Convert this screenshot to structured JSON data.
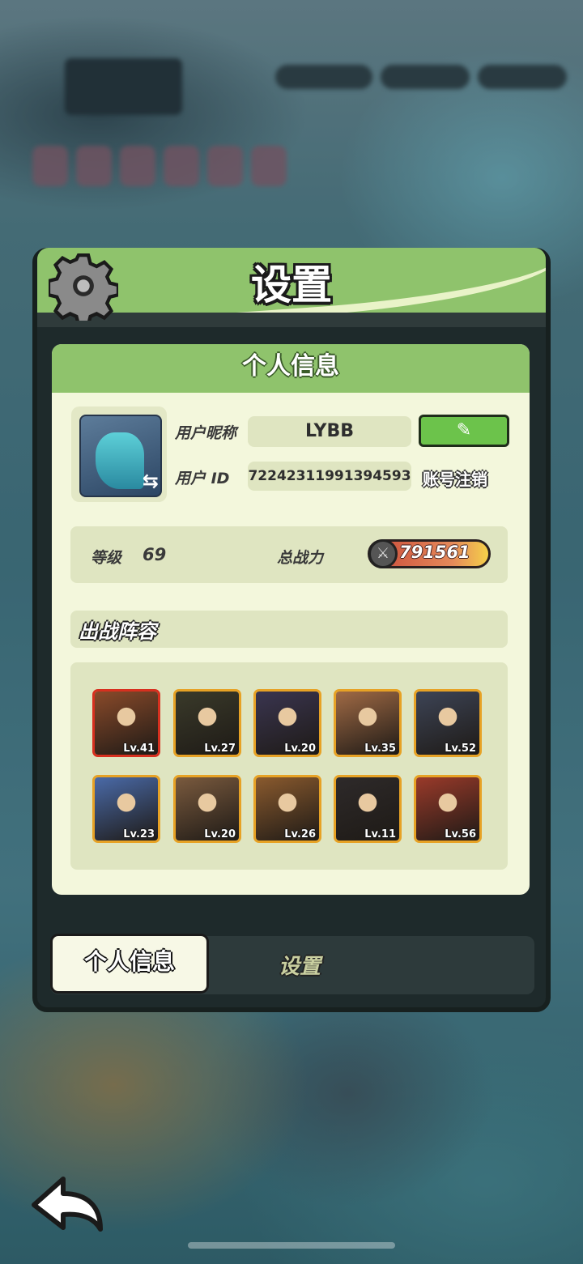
{
  "window": {
    "title": "设置"
  },
  "card": {
    "heading": "个人信息"
  },
  "profile": {
    "nickname_label": "用户昵称",
    "nickname_value": "LYBB",
    "id_label": "用户 ID",
    "id_value": "72242311991394593",
    "edit_icon": "pencil-icon",
    "cancel_account_label": "账号注销",
    "avatar_swap_icon": "swap-icon"
  },
  "stats": {
    "level_label": "等级",
    "level_value": "69",
    "power_label": "总战力",
    "power_value": "791561"
  },
  "lineup": {
    "heading": "出战阵容",
    "heroes": [
      {
        "level": "Lv.41",
        "frame": "red",
        "color": "#8a4a2a"
      },
      {
        "level": "Lv.27",
        "frame": "gold",
        "color": "#3a3a2a"
      },
      {
        "level": "Lv.20",
        "frame": "gold",
        "color": "#3a3550"
      },
      {
        "level": "Lv.35",
        "frame": "gold",
        "color": "#a06a45"
      },
      {
        "level": "Lv.52",
        "frame": "gold",
        "color": "#3d4456"
      },
      {
        "level": "Lv.23",
        "frame": "gold",
        "color": "#4a6aa8"
      },
      {
        "level": "Lv.20",
        "frame": "gold",
        "color": "#7a5a3e"
      },
      {
        "level": "Lv.26",
        "frame": "gold",
        "color": "#8a5a2e"
      },
      {
        "level": "Lv.11",
        "frame": "gold",
        "color": "#2e2a2a"
      },
      {
        "level": "Lv.56",
        "frame": "gold",
        "color": "#9a3a2a"
      }
    ]
  },
  "tabs": {
    "active": "个人信息",
    "inactive": "设置"
  },
  "icons": {
    "gear": "gear-icon",
    "back": "back-arrow-icon"
  },
  "colors": {
    "accent_green": "#8fc36c",
    "edit_button": "#6cc34b",
    "panel_bg": "#f3f7dc"
  }
}
